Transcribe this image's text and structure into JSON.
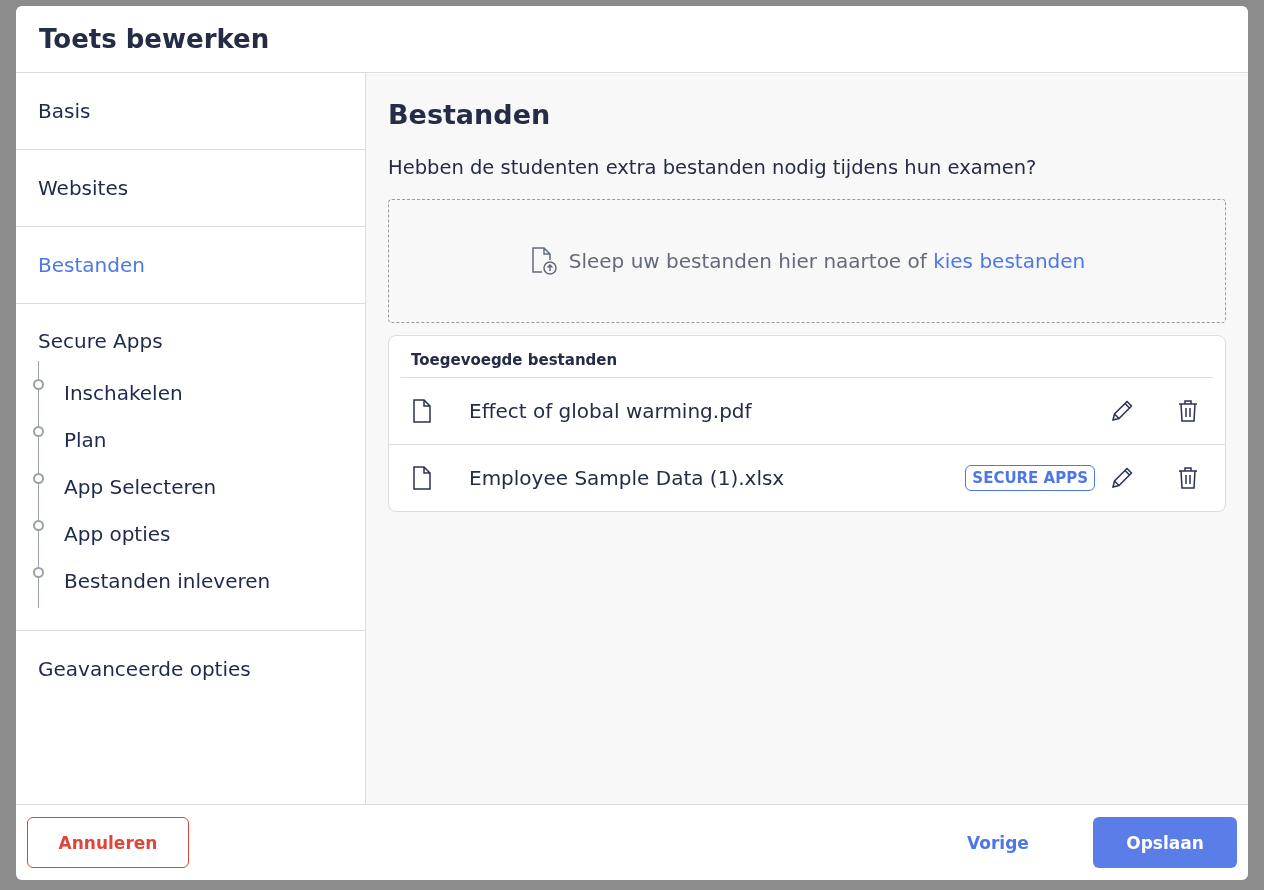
{
  "window": {
    "title": "Toets bewerken"
  },
  "sidebar": {
    "items": [
      {
        "label": "Basis",
        "selected": false
      },
      {
        "label": "Websites",
        "selected": false
      },
      {
        "label": "Bestanden",
        "selected": true
      },
      {
        "label": "Secure Apps",
        "selected": false,
        "children": [
          {
            "label": "Inschakelen",
            "selected": false
          },
          {
            "label": "Plan",
            "selected": false
          },
          {
            "label": "App Selecteren",
            "selected": false
          },
          {
            "label": "App opties",
            "selected": false
          },
          {
            "label": "Bestanden inleveren",
            "selected": false
          }
        ]
      },
      {
        "label": "Geavanceerde opties",
        "selected": false
      }
    ]
  },
  "content": {
    "heading": "Bestanden",
    "question": "Hebben de studenten extra bestanden nodig tijdens hun examen?",
    "dropzone": {
      "text": "Sleep uw bestanden hier naartoe of",
      "link": "kies bestanden"
    },
    "files": {
      "title": "Toegevoegde bestanden",
      "rows": [
        {
          "name": "Effect of global warming.pdf"
        },
        {
          "name": "Employee Sample Data (1).xlsx",
          "badge": "SECURE APPS"
        }
      ]
    }
  },
  "footer": {
    "cancel": "Annuleren",
    "back": "Vorige",
    "save": "Opslaan"
  }
}
